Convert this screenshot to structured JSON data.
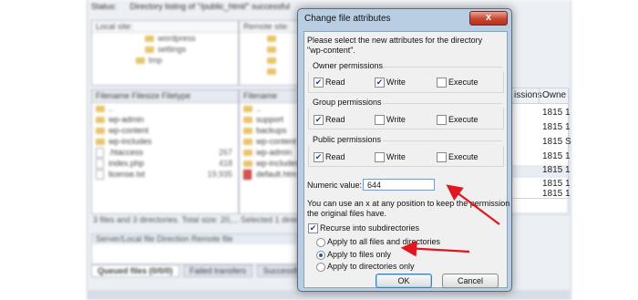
{
  "background": {
    "status_items": [
      "Status:",
      "Directory listing of \"/public_html/\" successful"
    ],
    "local_path_label": "Local site:",
    "remote_path_label": "Remote site:",
    "local_tree": [
      "wordpress",
      "settings",
      "tmp"
    ],
    "remote_tree_items": [
      "",
      "",
      "",
      ""
    ],
    "local_list_header": "Filename      Filesize Filetype",
    "remote_list_header": "Filename",
    "local_files": [
      {
        "name": "..",
        "size": ""
      },
      {
        "name": "wp-admin",
        "size": ""
      },
      {
        "name": "wp-content",
        "size": ""
      },
      {
        "name": "wp-includes",
        "size": ""
      },
      {
        "name": ".htaccess",
        "size": "267"
      },
      {
        "name": "index.php",
        "size": "418"
      },
      {
        "name": "license.txt",
        "size": "19,935"
      }
    ],
    "remote_files": [
      {
        "name": "..",
        "kind": "folder"
      },
      {
        "name": "support",
        "kind": "folder"
      },
      {
        "name": "backups",
        "kind": "folder"
      },
      {
        "name": "wp-content",
        "kind": "folder"
      },
      {
        "name": "wp-admin",
        "kind": "folder"
      },
      {
        "name": "wp-includes",
        "kind": "folder"
      },
      {
        "name": "default.htm",
        "kind": "doc"
      }
    ],
    "local_summary": "3 files and 3 directories. Total size: 20,...",
    "remote_summary": "Selected 1 directory.",
    "queue_header": "Server/Local file        Direction   Remote file",
    "tabs": [
      {
        "label": "Queued files (0/0/0)",
        "active": true
      },
      {
        "label": "Failed transfers",
        "active": false
      },
      {
        "label": "Successful transfers",
        "active": false
      }
    ],
    "right_list": {
      "col1": "issions",
      "col2": "Owne",
      "rows": [
        "1815 1",
        "1815 1",
        "1815 S",
        "1815 1",
        "1815 1",
        "1815 1",
        "1815 1"
      ]
    }
  },
  "dialog": {
    "title": "Change file attributes",
    "close_label": "x",
    "intro_line1": "Please select the new attributes for the directory",
    "intro_line2": "\"wp-content\".",
    "owner": {
      "heading": "Owner permissions",
      "read": "Read",
      "write": "Write",
      "execute": "Execute",
      "read_checked": true,
      "write_checked": true,
      "execute_checked": false
    },
    "group": {
      "heading": "Group permissions",
      "read": "Read",
      "write": "Write",
      "execute": "Execute",
      "read_checked": true,
      "write_checked": false,
      "execute_checked": false
    },
    "public": {
      "heading": "Public permissions",
      "read": "Read",
      "write": "Write",
      "execute": "Execute",
      "read_checked": true,
      "write_checked": false,
      "execute_checked": false
    },
    "numeric_label": "Numeric value:",
    "numeric_value": "644",
    "hint_line1": "You can use an x at any position to keep the permission",
    "hint_line2": "the original files have.",
    "recurse_label": "Recurse into subdirectories",
    "recurse_checked": true,
    "options": [
      {
        "label": "Apply to all files and directories",
        "selected": false
      },
      {
        "label": "Apply to files only",
        "selected": true
      },
      {
        "label": "Apply to directories only",
        "selected": false
      }
    ],
    "ok_label": "OK",
    "cancel_label": "Cancel"
  },
  "colors": {
    "annotation_arrow": "#e0171f",
    "checkmark": "#1f3f9a",
    "dialog_frame": "#b9cde3"
  }
}
